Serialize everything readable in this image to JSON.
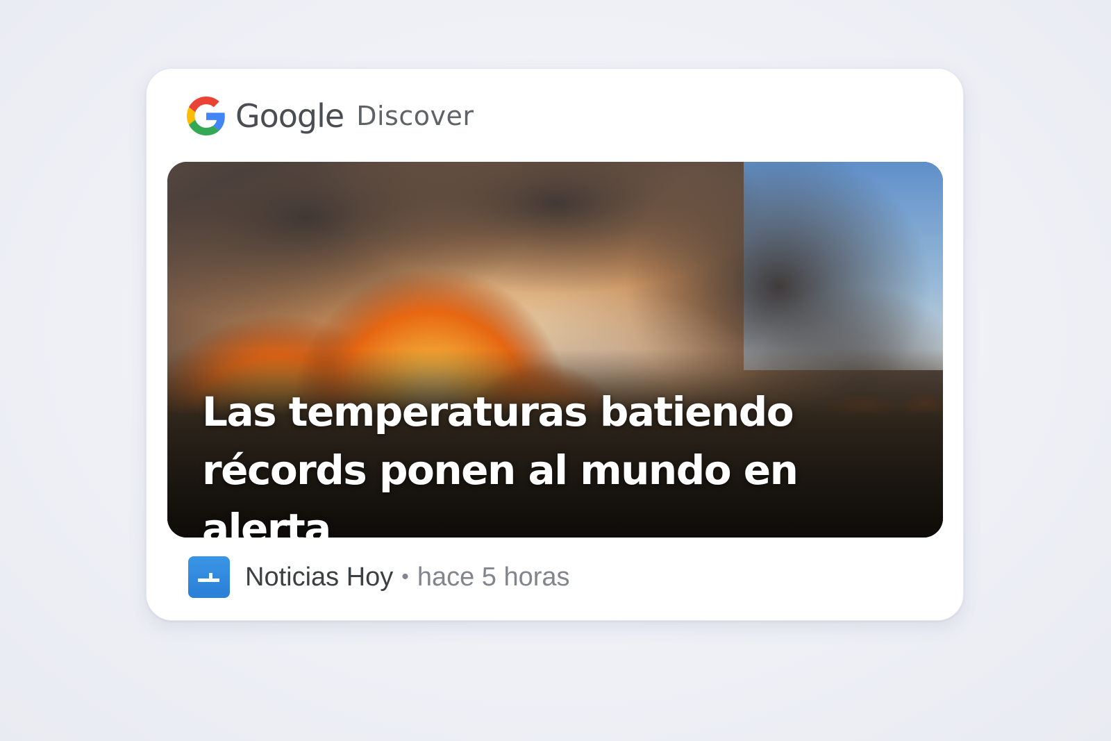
{
  "brand": {
    "logo_icon": "google-g-icon",
    "google_label": "Google",
    "product_label": "Discover",
    "colors": {
      "blue": "#4285F4",
      "red": "#EA4335",
      "yellow": "#FBBC05",
      "green": "#34A853"
    }
  },
  "article": {
    "image": "wildfire-grassland-image",
    "headline_line1": "Las temperaturas batiendo",
    "headline_line2": "récords ponen al mundo en alerta",
    "publisher": {
      "icon": "publisher-logo-icon",
      "icon_color": "#2f88dd",
      "name": "Noticias Hoy"
    },
    "separator": "•",
    "time": "hace 5 horas"
  }
}
